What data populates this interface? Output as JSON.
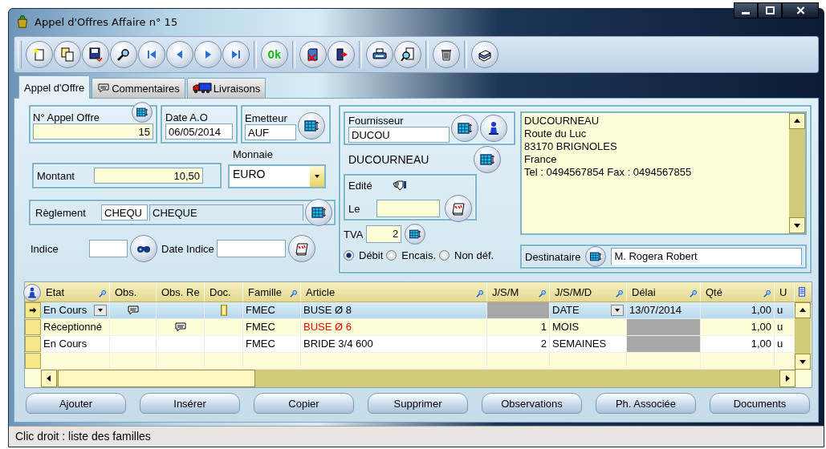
{
  "window": {
    "title": "Appel d'Offres Affaire n° 15"
  },
  "toolbar": {
    "ok_button": "Ok"
  },
  "tabs": [
    {
      "label": "Appel d'Offre",
      "selected": true
    },
    {
      "label": "Commentaires",
      "selected": false
    },
    {
      "label": "Livraisons",
      "selected": false
    }
  ],
  "form": {
    "numero": {
      "label": "N° Appel Offre",
      "value": "15"
    },
    "date": {
      "label": "Date A.O",
      "value": "06/05/2014"
    },
    "emetteur": {
      "label": "Emetteur",
      "value": "AUF"
    },
    "monnaie": {
      "label": "Monnaie",
      "value": "EURO"
    },
    "montant": {
      "label": "Montant",
      "value": "10,50"
    },
    "reglement": {
      "label": "Règlement",
      "code": "CHEQU",
      "value": "CHEQUE"
    },
    "indice": {
      "label": "Indice"
    },
    "date_indice": {
      "label": "Date Indice"
    }
  },
  "supplier": {
    "label": "Fournisseur",
    "code": "DUCOU",
    "name": "DUCOURNEAU",
    "edited": {
      "label": "Edité",
      "date_label": "Le"
    },
    "tva": {
      "label": "TVA",
      "value": "2"
    },
    "tva_modes": [
      {
        "label": "Débit",
        "selected": true
      },
      {
        "label": "Encais.",
        "selected": false
      },
      {
        "label": "Non déf.",
        "selected": false
      }
    ],
    "address": [
      "DUCOURNEAU",
      "Route du Luc",
      "83170 BRIGNOLES",
      "France",
      "Tel : 0494567854 Fax : 0494567855"
    ],
    "recipient": {
      "label": "Destinataire",
      "value": "M. Rogera Robert"
    }
  },
  "grid": {
    "columns": [
      {
        "label": "Etat",
        "searchable": true
      },
      {
        "label": "Obs.",
        "searchable": false
      },
      {
        "label": "Obs. Re",
        "searchable": false
      },
      {
        "label": "Doc.",
        "searchable": false
      },
      {
        "label": "Famille",
        "searchable": true
      },
      {
        "label": "Article",
        "searchable": true
      },
      {
        "label": "J/S/M",
        "searchable": true
      },
      {
        "label": "J/S/M/D",
        "searchable": true
      },
      {
        "label": "Délai",
        "searchable": true
      },
      {
        "label": "Qté",
        "searchable": true
      },
      {
        "label": "U",
        "searchable": false
      }
    ],
    "rows": [
      {
        "selected": true,
        "etat": "En Cours",
        "observation": true,
        "reception_note": false,
        "document": true,
        "famille": "FMEC",
        "article": "BUSE  Ø 8",
        "article_alert": false,
        "jsm": "",
        "jsm_locked": true,
        "jsmd": "DATE",
        "delai": "13/07/2014",
        "delai_locked": false,
        "qte": "1,00",
        "unit": "u"
      },
      {
        "selected": false,
        "etat": "Réceptionné",
        "observation": false,
        "reception_note": true,
        "document": false,
        "famille": "FMEC",
        "article": "BUSE Ø 6",
        "article_alert": true,
        "jsm": "1",
        "jsm_locked": false,
        "jsmd": "MOIS",
        "delai": "",
        "delai_locked": true,
        "qte": "1,00",
        "unit": "u"
      },
      {
        "selected": false,
        "etat": "En Cours",
        "observation": false,
        "reception_note": false,
        "document": false,
        "famille": "FMEC",
        "article": "BRIDE 3/4  600",
        "article_alert": false,
        "jsm": "2",
        "jsm_locked": false,
        "jsmd": "SEMAINES",
        "delai": "",
        "delai_locked": true,
        "qte": "1,00",
        "unit": "u"
      }
    ]
  },
  "buttons": [
    "Ajouter",
    "Insérer",
    "Copier",
    "Supprimer",
    "Observations",
    "Ph.  Associée",
    "Documents"
  ],
  "status_bar": "Clic droit : liste des familles"
}
